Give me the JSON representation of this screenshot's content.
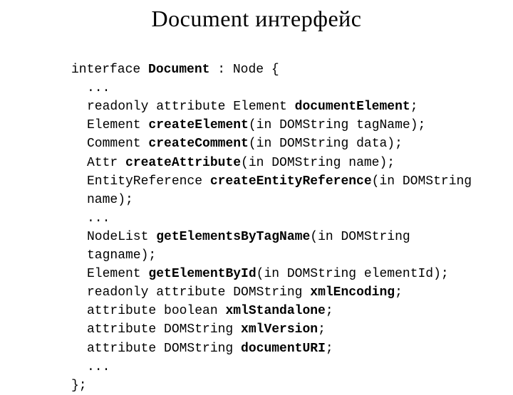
{
  "title": "Document интерфейс",
  "code": {
    "l0a": "interface ",
    "l0b": "Document",
    "l0c": " : Node {",
    "l1": "...",
    "l2a": "readonly attribute Element ",
    "l2b": "documentElement",
    "l2c": ";",
    "l3a": "Element ",
    "l3b": "createElement",
    "l3c": "(in DOMString tagName);",
    "l4a": "Comment ",
    "l4b": "createComment",
    "l4c": "(in DOMString data);",
    "l5a": "Attr ",
    "l5b": "createAttribute",
    "l5c": "(in DOMString name);",
    "l6a": "EntityReference ",
    "l6b": "createEntityReference",
    "l6c": "(in DOMString",
    "l7": "name);",
    "l8": "...",
    "l9a": "NodeList ",
    "l9b": "getElementsByTagName",
    "l9c": "(in DOMString",
    "l10": "tagname);",
    "l11a": "Element ",
    "l11b": "getElementById",
    "l11c": "(in DOMString elementId);",
    "l12a": "readonly attribute DOMString ",
    "l12b": "xmlEncoding",
    "l12c": ";",
    "l13a": "attribute boolean ",
    "l13b": "xmlStandalone",
    "l13c": ";",
    "l14a": "attribute DOMString ",
    "l14b": "xmlVersion",
    "l14c": ";",
    "l15a": "attribute DOMString ",
    "l15b": "documentURI",
    "l15c": ";",
    "l16": "...",
    "l17": "};"
  }
}
